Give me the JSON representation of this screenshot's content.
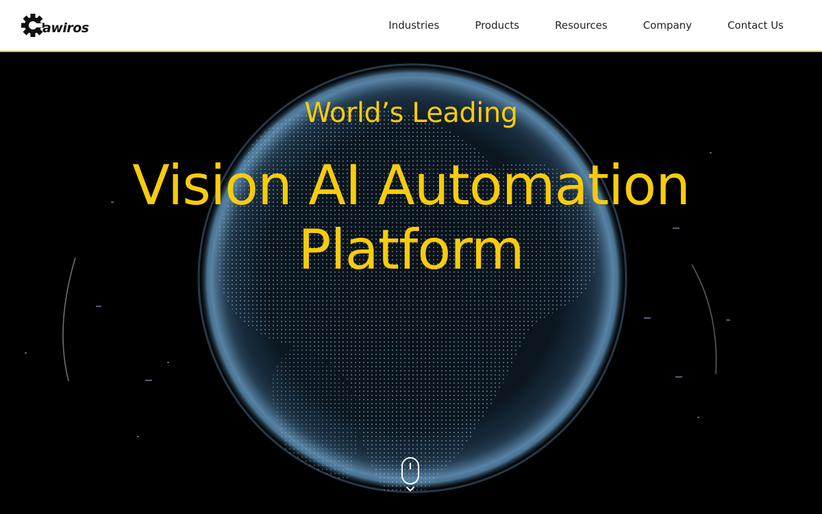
{
  "header": {
    "logo_text": "awiros",
    "logo_icon": "gear-icon",
    "nav": [
      {
        "label": "Industries"
      },
      {
        "label": "Products"
      },
      {
        "label": "Resources"
      },
      {
        "label": "Company"
      },
      {
        "label": "Contact Us"
      }
    ]
  },
  "hero": {
    "eyebrow": "World’s Leading",
    "title_line1": "Vision AI Automation",
    "title_line2": "Platform",
    "background": "globe-image",
    "scroll_icon": "mouse-scroll-icon",
    "scroll_chevron_icon": "chevron-down-icon"
  },
  "colors": {
    "accent": "#f9cc0b",
    "header_bg": "#ffffff",
    "hero_bg": "#000000",
    "header_border": "#f4c20d"
  }
}
